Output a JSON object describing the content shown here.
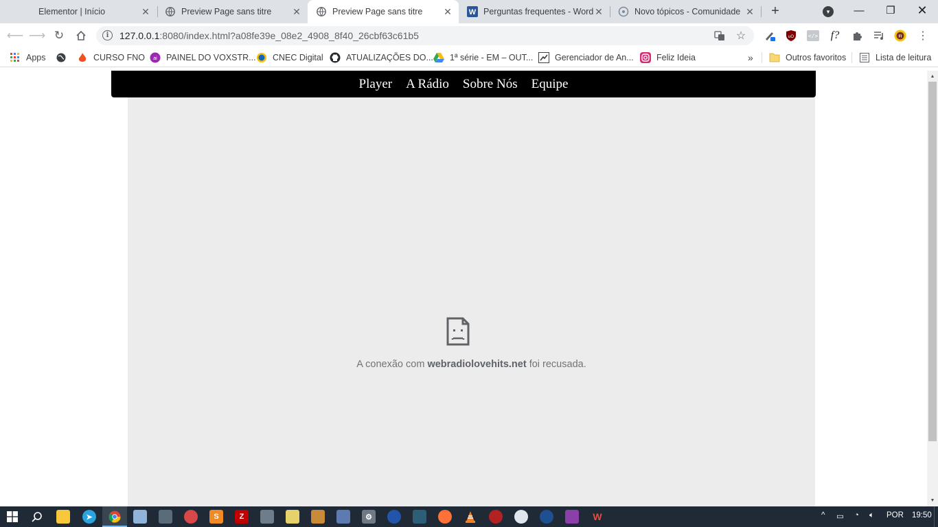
{
  "browser": {
    "tabs": [
      {
        "title": "Elementor | Início",
        "icon": "elementor-icon"
      },
      {
        "title": "Preview Page sans titre",
        "icon": "globe-icon"
      },
      {
        "title": "Preview Page sans titre",
        "icon": "globe-icon",
        "active": true
      },
      {
        "title": "Perguntas frequentes - WordPress",
        "icon": "word-icon"
      },
      {
        "title": "Novo tópicos - Comunidade",
        "icon": "community-icon"
      }
    ],
    "url_host": "127.0.0.1",
    "url_rest": ":8080/index.html?a08fe39e_08e2_4908_8f40_26cbf63c61b5"
  },
  "bookmarks": {
    "items": [
      {
        "label": "Apps",
        "icon": "apps-grid-icon"
      },
      {
        "label": "",
        "icon": "globe-dark-icon"
      },
      {
        "label": "CURSO FNO",
        "icon": "flame-icon"
      },
      {
        "label": "PAINEL DO VOXSTR...",
        "icon": "voxstream-icon"
      },
      {
        "label": "CNEC Digital",
        "icon": "cnec-icon"
      },
      {
        "label": "ATUALIZAÇÕES DO...",
        "icon": "github-icon"
      },
      {
        "label": "1ª série - EM – OUT...",
        "icon": "google-drive-icon"
      },
      {
        "label": "Gerenciador de An...",
        "icon": "ads-manager-icon"
      },
      {
        "label": "Feliz Ideia",
        "icon": "instagram-icon"
      }
    ],
    "more": "»",
    "other": "Outros favoritos",
    "reading_list": "Lista de leitura"
  },
  "site": {
    "nav": [
      "Player",
      "A Rádio",
      "Sobre Nós",
      "Equipe"
    ]
  },
  "error": {
    "prefix": "A conexão com ",
    "host": "webradiolovehits.net",
    "suffix": " foi recusada."
  },
  "taskbar": {
    "language": "POR",
    "time": "19:50"
  },
  "colors": {
    "tabstrip": "#dee1e6",
    "frame_bg": "#ececec",
    "nav_bg": "#000000",
    "taskbar": "#1f2a36"
  }
}
